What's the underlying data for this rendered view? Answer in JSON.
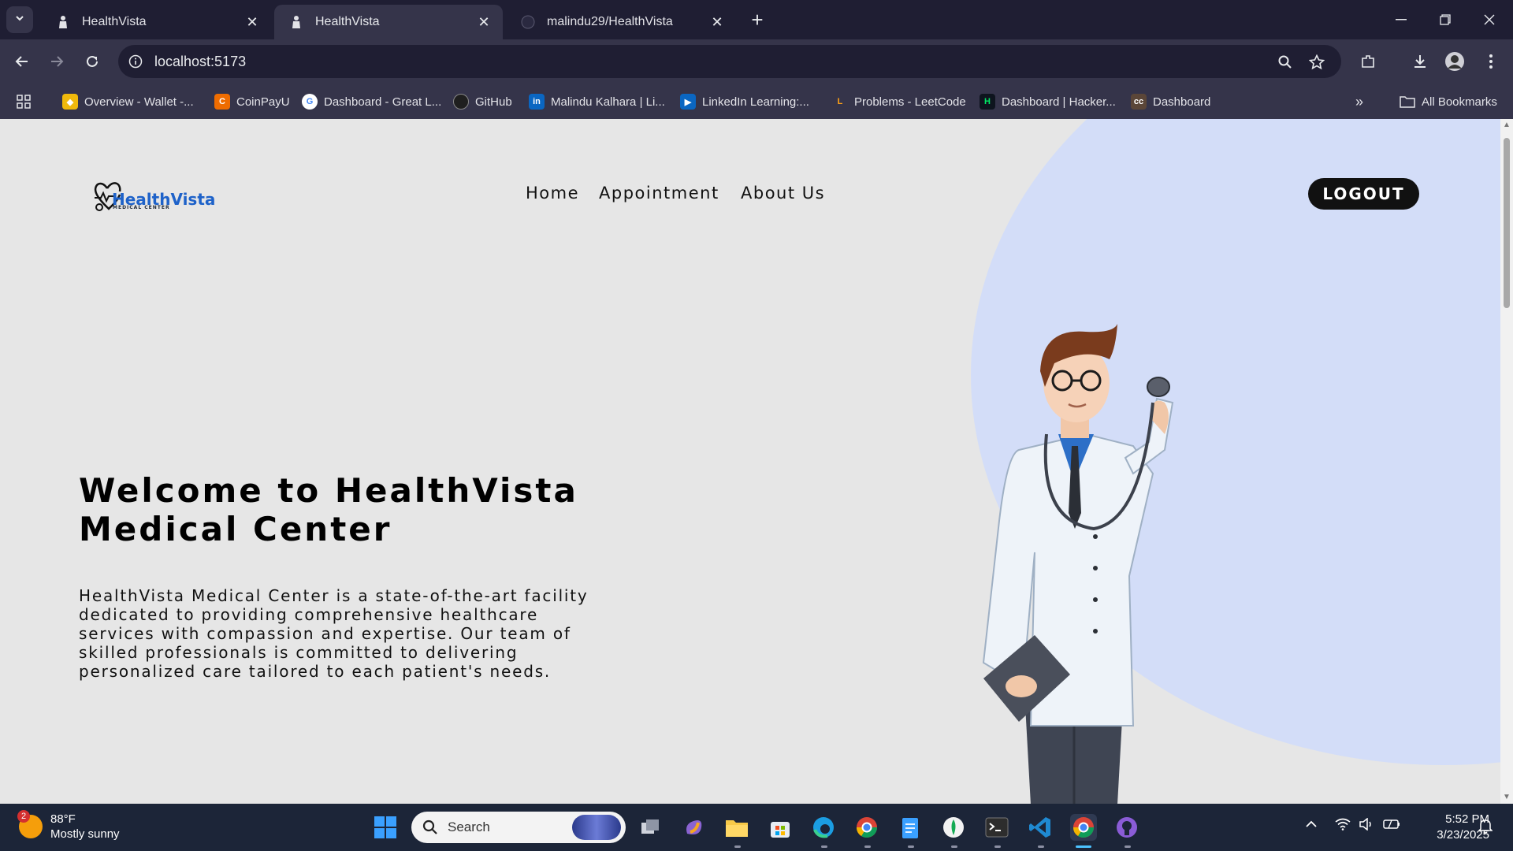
{
  "browser": {
    "tabs": [
      {
        "title": "HealthVista",
        "active": false
      },
      {
        "title": "HealthVista",
        "active": true
      },
      {
        "title": "malindu29/HealthVista",
        "active": false
      }
    ],
    "url": "localhost:5173",
    "bookmarks": [
      {
        "label": "Overview - Wallet -...",
        "icon": "binance-icon",
        "color": "#f0b90b"
      },
      {
        "label": "CoinPayU",
        "icon": "coinpayu-icon",
        "color": "#ef6c00"
      },
      {
        "label": "Dashboard - Great L...",
        "icon": "greatlearning-icon",
        "color": "#4285f4"
      },
      {
        "label": "GitHub",
        "icon": "github-icon",
        "color": "#1f1f1f"
      },
      {
        "label": "Malindu Kalhara | Li...",
        "icon": "linkedin-icon",
        "color": "#0a66c2"
      },
      {
        "label": "LinkedIn Learning:...",
        "icon": "linkedin-learning-icon",
        "color": "#0a66c2"
      },
      {
        "label": "Problems - LeetCode",
        "icon": "leetcode-icon",
        "color": "#ffa116"
      },
      {
        "label": "Dashboard | Hacker...",
        "icon": "hackerrank-icon",
        "color": "#00ea64"
      },
      {
        "label": "Dashboard",
        "icon": "codechef-icon",
        "color": "#5b4638"
      }
    ],
    "all_bookmarks": "All Bookmarks"
  },
  "page": {
    "logo_name": "HealthVista",
    "logo_sub": "MEDICAL CENTER",
    "nav": [
      "Home",
      "Appointment",
      "About Us"
    ],
    "logout": "LOGOUT",
    "hero_title": "Welcome to HealthVista Medical Center",
    "hero_description": "HealthVista Medical Center is a state-of-the-art facility dedicated to providing comprehensive healthcare services with compassion and expertise. Our team of skilled professionals is committed to delivering personalized care tailored to each patient's needs."
  },
  "taskbar": {
    "weather_badge": "2",
    "temperature": "88°F",
    "condition": "Mostly sunny",
    "search_label": "Search",
    "time": "5:52 PM",
    "date": "3/23/2025"
  },
  "colors": {
    "accent_blue": "#1e62c9",
    "blob": "#d3ddf8",
    "page_bg": "#e6e6e6",
    "tab_bg": "#1f1e33",
    "toolbar_bg": "#35344a"
  }
}
